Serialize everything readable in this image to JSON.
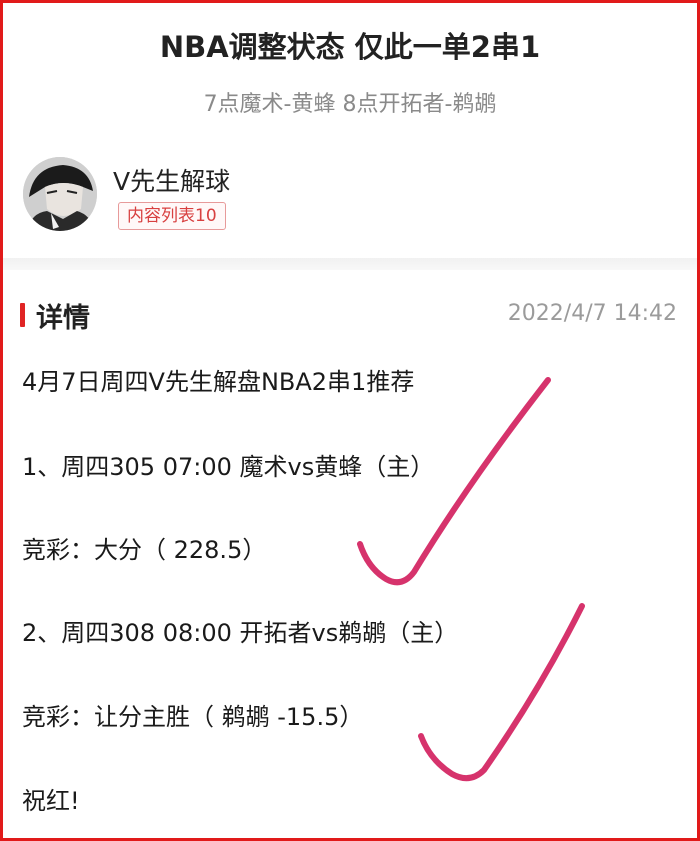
{
  "article": {
    "title": "NBA调整状态 仅此一单2串1",
    "subtitle": "7点魔术-黄蜂 8点开拓者-鹈鹕"
  },
  "author": {
    "name": "V先生解球",
    "badge": "内容列表10"
  },
  "details": {
    "heading": "详情",
    "date": "2022/4/7 14:42",
    "lines": [
      "4月7日周四V先生解盘NBA2串1推荐",
      "1、周四305 07:00 魔术vs黄蜂（主）",
      "竞彩：大分（ 228.5）",
      "2、周四308 08:00 开拓者vs鹈鹕（主）",
      "竞彩：让分主胜（ 鹈鹕 -15.5）",
      "祝红!"
    ]
  },
  "colors": {
    "frame": "#e11a1a",
    "accent": "#e02424",
    "checkmark": "#d6336c"
  }
}
